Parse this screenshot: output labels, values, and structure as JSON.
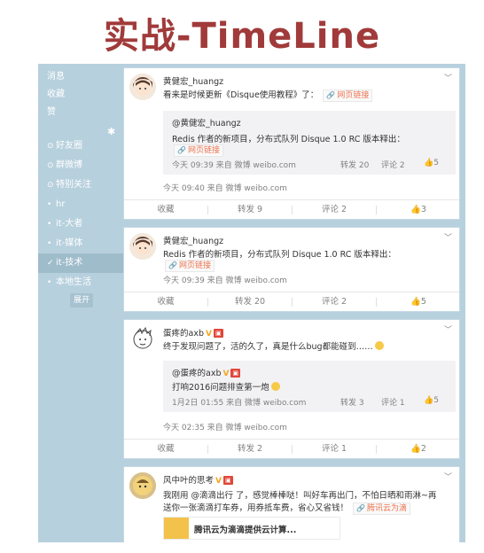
{
  "banner": {
    "title": "实战-TimeLine"
  },
  "sidebar": {
    "items": [
      {
        "label": "消息",
        "icon": "",
        "active": false
      },
      {
        "label": "收藏",
        "icon": "",
        "active": false
      },
      {
        "label": "赞",
        "icon": "",
        "active": false
      },
      {
        "label": "好友圈",
        "icon": "friends-icon",
        "active": false
      },
      {
        "label": "群微博",
        "icon": "group-icon",
        "active": false
      },
      {
        "label": "特别关注",
        "icon": "star-icon",
        "active": false
      },
      {
        "label": "hr",
        "icon": "dot",
        "active": false
      },
      {
        "label": "it-大者",
        "icon": "dot",
        "active": false
      },
      {
        "label": "it-媒体",
        "icon": "dot",
        "active": false
      },
      {
        "label": "it-技术",
        "icon": "check",
        "active": true
      },
      {
        "label": "本地生活",
        "icon": "dot",
        "active": false
      }
    ],
    "expand_label": "展开"
  },
  "posts": [
    {
      "username": "黄健宏_huangz",
      "text": "看来是时候更新《Disque使用教程》了：",
      "link_label": "网页链接",
      "repost": {
        "username": "@黄健宏_huangz",
        "text": "Redis 作者的新项目，分布式队列 Disque 1.0 RC 版本释出：",
        "link_label": "网页链接",
        "meta": "今天 09:39 来自 微博 weibo.com",
        "forward": "转发 20",
        "comment": "评论 2",
        "like": "5"
      },
      "meta": "今天 09:40 来自 微博 weibo.com",
      "actions": {
        "fav": "收藏",
        "forward": "转发 9",
        "comment": "评论 2",
        "like": "3"
      }
    },
    {
      "username": "黄健宏_huangz",
      "text": "Redis 作者的新项目，分布式队列 Disque 1.0 RC 版本释出：",
      "link_label": "网页链接",
      "meta": "今天 09:39 来自 微博 weibo.com",
      "actions": {
        "fav": "收藏",
        "forward": "转发 20",
        "comment": "评论 2",
        "like": "5"
      }
    },
    {
      "username": "蛋疼的axb",
      "text": "终于发现问题了，活的久了，真是什么bug都能碰到……",
      "repost": {
        "username": "@蛋疼的axb",
        "text": "打响2016问题排查第一炮",
        "meta": "1月2日 01:55 来自 微博 weibo.com",
        "forward": "转发 3",
        "comment": "评论 1",
        "like": "5"
      },
      "meta": "今天 02:35 来自 微博 weibo.com",
      "actions": {
        "fav": "收藏",
        "forward": "转发 2",
        "comment": "评论 1",
        "like": "2"
      }
    },
    {
      "username": "风中叶的思考",
      "text_line1": "我刚用 @滴滴出行 了，感觉棒棒哒！叫好车再出门，不怕日晒和雨淋~再",
      "mention": "@滴滴出行",
      "text_line2": "送你一张滴滴打车券，用券抵车费，省心又省钱！",
      "link_label": "腾讯云为滴",
      "ad_text": "腾讯云为滴滴提供云计算..."
    }
  ],
  "colors": {
    "banner": "#a13a3a",
    "sidebar": "#b7d0dd",
    "link": "#eb7350"
  }
}
